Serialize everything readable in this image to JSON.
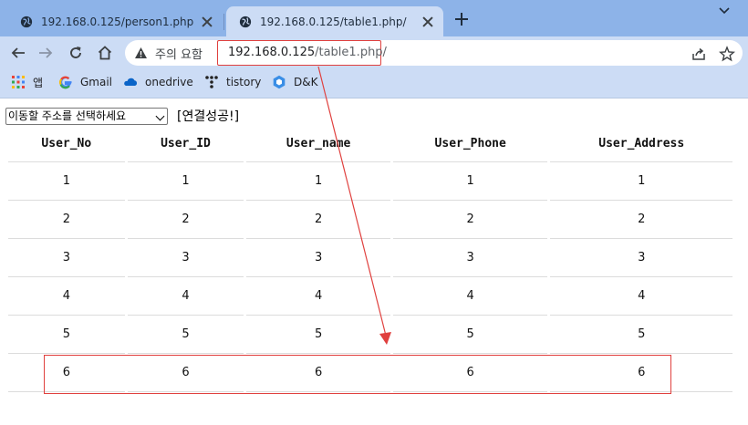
{
  "browser": {
    "tabs": [
      {
        "title": "192.168.0.125/person1.php",
        "active": false
      },
      {
        "title": "192.168.0.125/table1.php/",
        "active": true
      }
    ],
    "security_label": "주의 요함",
    "url_host": "192.168.0.125",
    "url_path": "/table1.php/",
    "bookmarks": [
      {
        "label": "앱",
        "icon": "apps-grid-icon"
      },
      {
        "label": "Gmail",
        "icon": "google-icon"
      },
      {
        "label": "onedrive",
        "icon": "cloud-icon"
      },
      {
        "label": "tistory",
        "icon": "tistory-icon"
      },
      {
        "label": "D&K",
        "icon": "hexagon-icon"
      }
    ],
    "colors": {
      "tabstrip": "#8db3e8",
      "toolbar": "#ccdcf5",
      "annotation": "#e0403e"
    }
  },
  "page": {
    "select_value": "이동할 주소를 선택하세요",
    "status_text": "[연결성공!]",
    "table": {
      "headers": [
        "User_No",
        "User_ID",
        "User_name",
        "User_Phone",
        "User_Address"
      ],
      "rows": [
        [
          "1",
          "1",
          "1",
          "1",
          "1"
        ],
        [
          "2",
          "2",
          "2",
          "2",
          "2"
        ],
        [
          "3",
          "3",
          "3",
          "3",
          "3"
        ],
        [
          "4",
          "4",
          "4",
          "4",
          "4"
        ],
        [
          "5",
          "5",
          "5",
          "5",
          "5"
        ],
        [
          "6",
          "6",
          "6",
          "6",
          "6"
        ]
      ]
    }
  }
}
